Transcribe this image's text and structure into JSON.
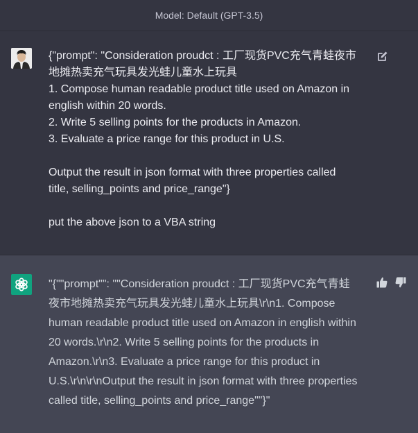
{
  "header": {
    "model_label": "Model: Default (GPT-3.5)"
  },
  "user_message": {
    "lines": [
      "{\"prompt\": \"Consideration proudct : 工厂现货PVC充气青蛙夜市",
      "地摊热卖充气玩具发光蛙儿童水上玩具",
      "1. Compose human readable product title used on Amazon in",
      "english within 20 words.",
      "2. Write 5 selling points for the products in Amazon.",
      "3. Evaluate a price range for this product in U.S.",
      "",
      "Output the result in json format with three properties called",
      "title, selling_points and price_range\"}",
      "",
      "put the above json to a VBA string"
    ]
  },
  "assistant_message": {
    "lines": [
      "\"{\"\"prompt\"\": \"\"Consideration proudct : 工厂现货PVC充气青蛙",
      "夜市地摊热卖充气玩具发光蛙儿童水上玩具\\r\\n1. Compose",
      "human readable product title used on Amazon in english within",
      "20 words.\\r\\n2. Write 5 selling points for the products in",
      "Amazon.\\r\\n3. Evaluate a price range for this product in",
      "U.S.\\r\\n\\r\\nOutput the result in json format with three properties",
      "called title, selling_points and price_range\"\"}\""
    ]
  },
  "icons": {
    "user_avatar": "user-avatar-photo",
    "assistant_avatar": "openai-logo-icon",
    "edit": "edit-icon",
    "thumbs_up": "thumbs-up-icon",
    "thumbs_down": "thumbs-down-icon"
  },
  "colors": {
    "header_bg": "#343541",
    "user_bg": "#343541",
    "assistant_bg": "#444654",
    "assistant_avatar_bg": "#10a37f",
    "text": "#ececf1"
  }
}
